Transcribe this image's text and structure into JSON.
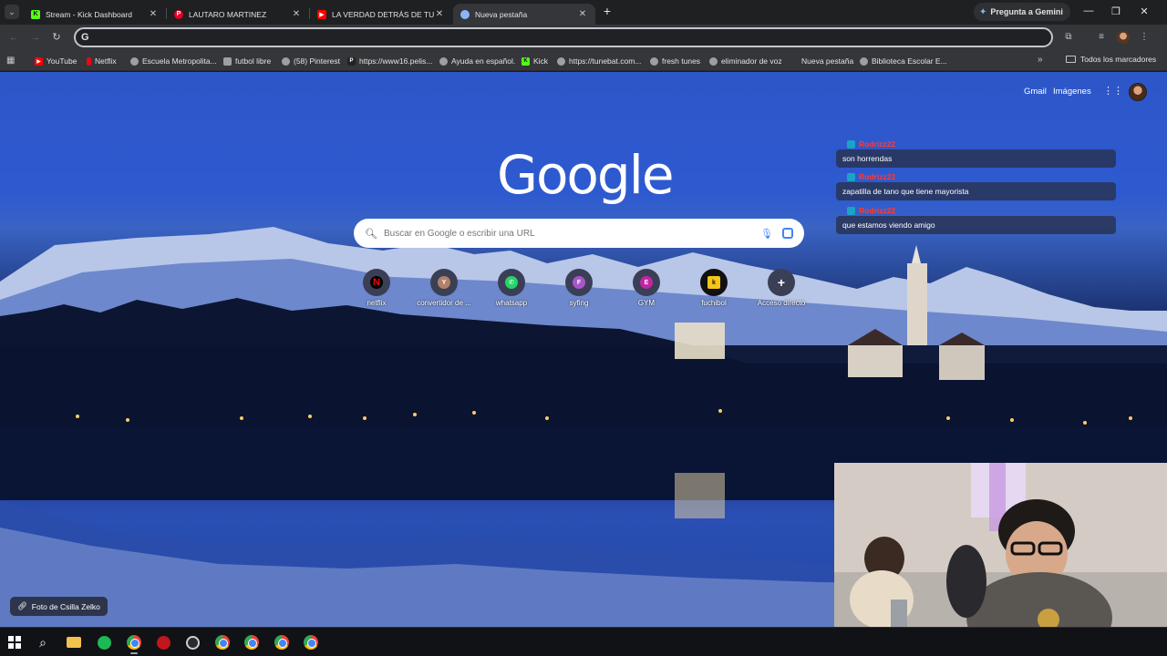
{
  "browser": {
    "tabs": [
      {
        "title": "Stream - Kick Dashboard",
        "favicon": "kick-icon",
        "color": "#53fc18"
      },
      {
        "title": "LAUTARO MARTINEZ",
        "favicon": "pinterest-icon",
        "color": "#e60023"
      },
      {
        "title": "LA VERDAD DETRÁS DE TU CON",
        "favicon": "youtube-icon",
        "color": "#ff0000"
      },
      {
        "title": "Nueva pestaña",
        "favicon": "chrome-icon",
        "color": "#8ab4f8"
      }
    ],
    "gemini_label": "Pregunta a Gemini",
    "address_value": ""
  },
  "bookmarks": {
    "items": [
      {
        "label": "YouTube",
        "icon": "youtube-icon",
        "color": "#ff0000"
      },
      {
        "label": "Netflix",
        "icon": "netflix-icon",
        "color": "#e50914"
      },
      {
        "label": "Escuela Metropolita...",
        "icon": "globe-icon",
        "color": "#9aa0a6"
      },
      {
        "label": "futbol libre",
        "icon": "image-icon",
        "color": "#9aa0a6"
      },
      {
        "label": "(58) Pinterest",
        "icon": "globe-icon",
        "color": "#9aa0a6"
      },
      {
        "label": "https://www16.pelis...",
        "icon": "p-icon",
        "color": "#222"
      },
      {
        "label": "Ayuda en español.",
        "icon": "help-icon",
        "color": "#9aa0a6"
      },
      {
        "label": "Kick",
        "icon": "kick-icon",
        "color": "#53fc18"
      },
      {
        "label": "https://tunebat.com...",
        "icon": "globe-icon",
        "color": "#9aa0a6"
      },
      {
        "label": "fresh tunes",
        "icon": "globe-icon",
        "color": "#9aa0a6"
      },
      {
        "label": "eliminador de voz",
        "icon": "globe-icon",
        "color": "#9aa0a6"
      },
      {
        "label": "Nueva pestaña",
        "icon": "none",
        "color": "#35363a"
      },
      {
        "label": "Biblioteca Escolar E...",
        "icon": "globe-icon",
        "color": "#9aa0a6"
      }
    ],
    "all_label": "Todos los marcadores"
  },
  "newtab": {
    "gmail": "Gmail",
    "images": "Imágenes",
    "logo": "Google",
    "search_placeholder": "Buscar en Google o escribir una URL",
    "shortcuts": [
      {
        "label": "netflix",
        "letter": "N",
        "color": "#e50914",
        "inner": "#000000"
      },
      {
        "label": "convertidor de ...",
        "letter": "Y",
        "color": "#b0806a",
        "inner": "#b0806a"
      },
      {
        "label": "whatsapp",
        "letter": "✆",
        "color": "#25d366",
        "inner": "#25d366"
      },
      {
        "label": "syfing",
        "letter": "F",
        "color": "#a855c8",
        "inner": "#a855c8"
      },
      {
        "label": "GYM",
        "letter": "E",
        "color": "#c026a3",
        "inner": "#c026a3"
      },
      {
        "label": "fuchibol",
        "letter": "k",
        "color": "#111111",
        "inner": "#f5c518"
      },
      {
        "label": "Acceso directo",
        "letter": "+",
        "color": "#3b3f55",
        "inner": "#3b3f55"
      }
    ],
    "photo_credit": "Foto de Csilla Zelko"
  },
  "chat": [
    {
      "user": "Rodrizz22",
      "message": "son horrendas"
    },
    {
      "user": "Rodrizz22",
      "message": "zapatilla de tano que tiene mayorista"
    },
    {
      "user": "Rodrizz22",
      "message": "que estamos viendo amigo"
    }
  ]
}
